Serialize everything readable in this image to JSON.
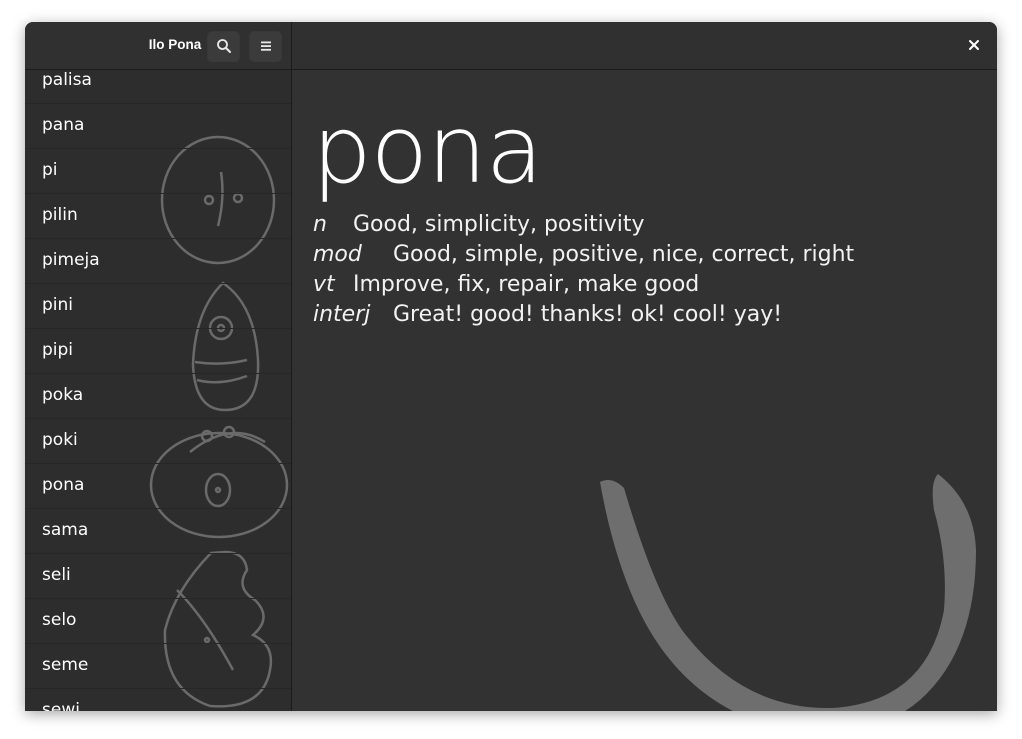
{
  "app": {
    "title": "Ilo Pona"
  },
  "header": {
    "search_icon": "search-icon",
    "menu_icon": "hamburger-menu-icon",
    "close_icon": "close-icon"
  },
  "sidebar": {
    "words": [
      "palisa",
      "pana",
      "pi",
      "pilin",
      "pimeja",
      "pini",
      "pipi",
      "poka",
      "poki",
      "pona",
      "sama",
      "seli",
      "selo",
      "seme",
      "sewi"
    ]
  },
  "entry": {
    "word": "pona",
    "definitions": [
      {
        "pos": "n",
        "gloss": "Good, simplicity, positivity"
      },
      {
        "pos": "mod",
        "gloss": "Good, simple, positive, nice, correct, right"
      },
      {
        "pos": "vt",
        "gloss": "Improve, fix, repair, make good"
      },
      {
        "pos": "interj",
        "gloss": "Great! good! thanks! ok! cool! yay!"
      }
    ]
  },
  "colors": {
    "window_bg": "#2f2f2f",
    "content_bg": "#323232",
    "glyph_gray": "#6e6e6e",
    "text": "#ffffff"
  }
}
